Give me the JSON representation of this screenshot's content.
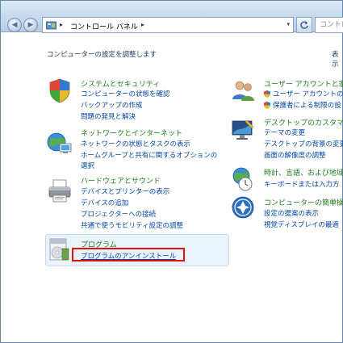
{
  "address_bar": {
    "separator": "▸",
    "breadcrumb": "コントロール パネル",
    "trailing_separator": "▸",
    "dropdown_glyph": "▾"
  },
  "search": {
    "placeholder": "コントロール"
  },
  "heading": "コンピューターの設定を調整します",
  "view_by_label": "表示",
  "categories": [
    {
      "title": "システムとセキュリティ",
      "icon": "shield-flag-icon",
      "links": [
        "コンピューターの状態を確認",
        "バックアップの作成",
        "問題の発見と解決"
      ]
    },
    {
      "title": "ネットワークとインターネット",
      "icon": "network-globe-icon",
      "links": [
        "ネットワークの状態とタスクの表示",
        "ホームグループと共有に関するオプションの",
        "選択"
      ]
    },
    {
      "title": "ハードウェアとサウンド",
      "icon": "printer-icon",
      "links": [
        "デバイスとプリンターの表示",
        "デバイスの追加",
        "プロジェクターへの接続",
        "共通で使うモビリティ設定の調整"
      ]
    },
    {
      "title": "プログラム",
      "icon": "programs-icon",
      "links": [
        "プログラムのアンインストール"
      ]
    },
    {
      "title": "ユーザー アカウントと家",
      "icon": "users-icon",
      "links": [
        "ユーザー アカウントの",
        "保護者による制限の設"
      ]
    },
    {
      "title": "デスクトップのカスタマイ",
      "icon": "desktop-personalize-icon",
      "links": [
        "テーマの変更",
        "デスクトップの背景の変更",
        "画面の解像度の調整"
      ]
    },
    {
      "title": "時計、言語、および地域",
      "icon": "clock-globe-icon",
      "links": [
        "キーボードまたは入力方"
      ]
    },
    {
      "title": "コンピューターの簡単操作",
      "icon": "ease-of-access-icon",
      "links": [
        "設定の提案の表示",
        "視覚ディスプレイの最適"
      ]
    }
  ],
  "colors": {
    "category_title": "#1e7a1e",
    "link": "#0046a8",
    "highlight_border": "#e01010"
  }
}
